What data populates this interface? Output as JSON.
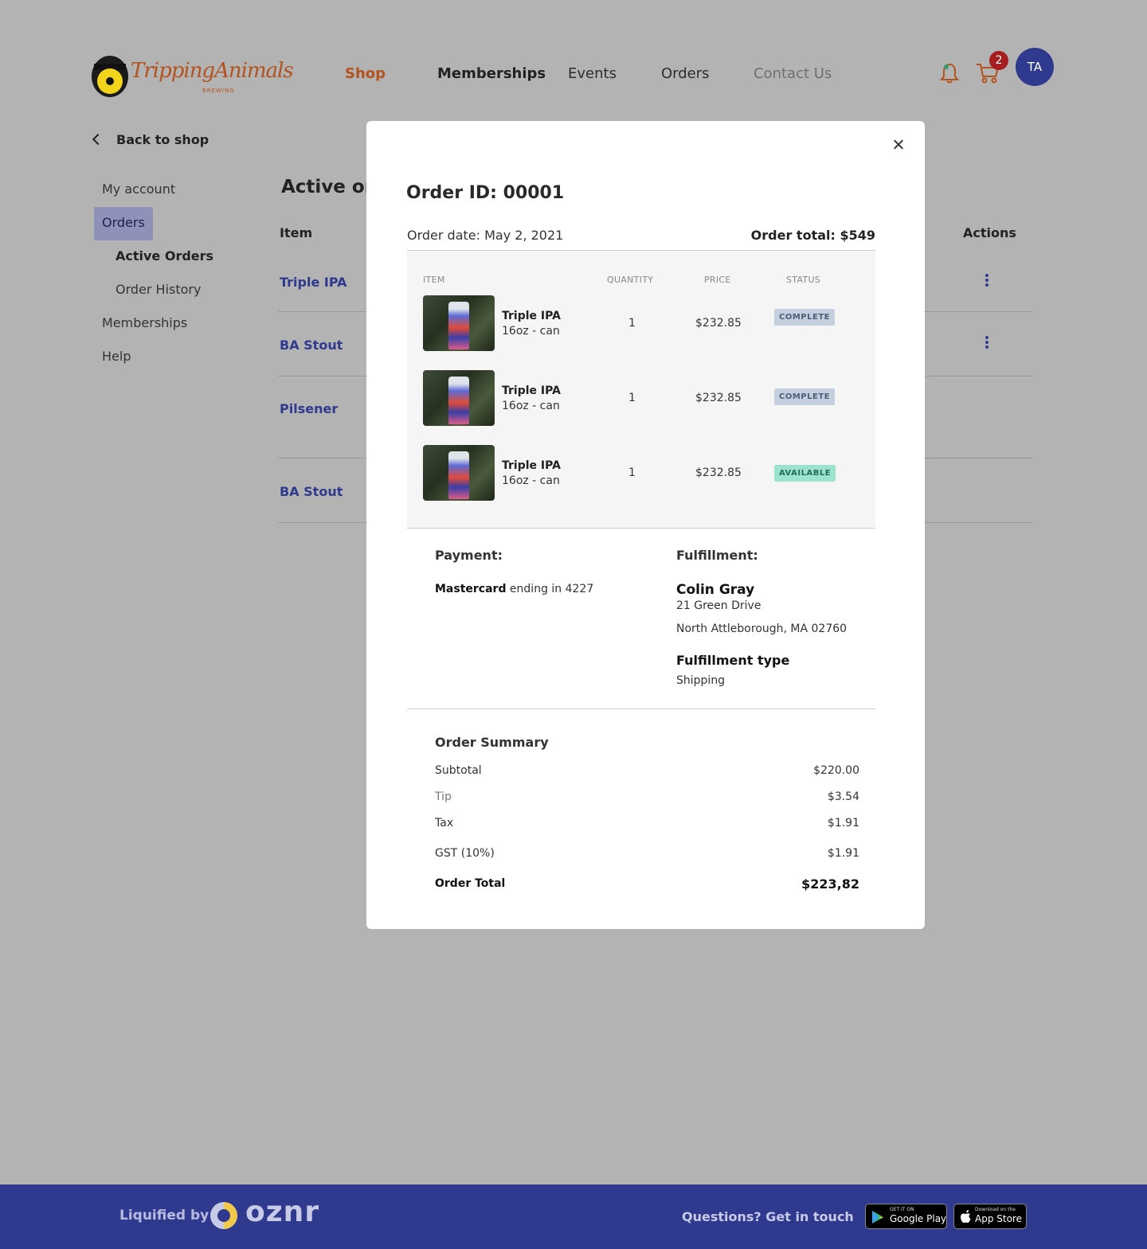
{
  "brand": {
    "logo_text": "TrippingAnimals",
    "logo_sub": "BREWING"
  },
  "nav": {
    "shop": "Shop",
    "memberships": "Memberships",
    "events": "Events",
    "orders": "Orders",
    "contact": "Contact Us"
  },
  "header_actions": {
    "cart_count": "2",
    "avatar_initials": "TA"
  },
  "sidebar": {
    "back": "Back to shop",
    "my_account": "My account",
    "orders": "Orders",
    "active_orders": "Active Orders",
    "order_history": "Order History",
    "memberships": "Memberships",
    "help": "Help"
  },
  "background": {
    "title": "Active ord",
    "col_item": "Item",
    "col_actions": "Actions",
    "rows": [
      "Triple IPA",
      "BA Stout",
      "Pilsener",
      "BA Stout"
    ]
  },
  "modal": {
    "order_id": "Order ID:  00001",
    "order_date": "Order date: May 2, 2021",
    "order_total": "Order total: $549",
    "columns": {
      "item": "ITEM",
      "quantity": "QUANTITY",
      "price": "PRICE",
      "status": "STATUS"
    },
    "items": [
      {
        "name": "Triple IPA",
        "variant": "16oz - can",
        "quantity": "1",
        "price": "$232.85",
        "status": "COMPLETE"
      },
      {
        "name": "Triple IPA",
        "variant": "16oz - can",
        "quantity": "1",
        "price": "$232.85",
        "status": "COMPLETE"
      },
      {
        "name": "Triple IPA",
        "variant": "16oz - can",
        "quantity": "1",
        "price": "$232.85",
        "status": "AVAILABLE"
      }
    ],
    "payment": {
      "label": "Payment:",
      "card": "Mastercard",
      "ending": " ending in 4227"
    },
    "fulfillment": {
      "label": "Fulfillment:",
      "name": "Colin Gray",
      "address1": "21 Green Drive",
      "address2": "North Attleborough, MA 02760",
      "type_label": "Fulfillment type",
      "type_value": "Shipping"
    },
    "summary": {
      "title": "Order Summary",
      "subtotal_label": "Subtotal",
      "subtotal": "$220.00",
      "tip_label": "Tip",
      "tip": "$3.54",
      "tax_label": "Tax",
      "tax": "$1.91",
      "gst_label": "GST (10%)",
      "gst": "$1.91",
      "total_label": "Order Total",
      "total": "$223,82"
    }
  },
  "footer": {
    "liquified": "Liquified by",
    "oznr": "oznr",
    "get_in_touch": "Questions? Get in touch",
    "google_small": "GET IT ON",
    "google_big": "Google Play",
    "apple_small": "Download on the",
    "apple_big": "App Store"
  },
  "colors": {
    "accent_orange": "#b3531f",
    "brand_blue": "#2f3a8f",
    "complete_badge": "#c3cfdc",
    "available_badge": "#9be3cf"
  },
  "icons": [
    "bell-icon",
    "cart-icon",
    "chevron-left-icon",
    "close-icon",
    "kebab-icon",
    "google-play-icon",
    "apple-icon"
  ]
}
